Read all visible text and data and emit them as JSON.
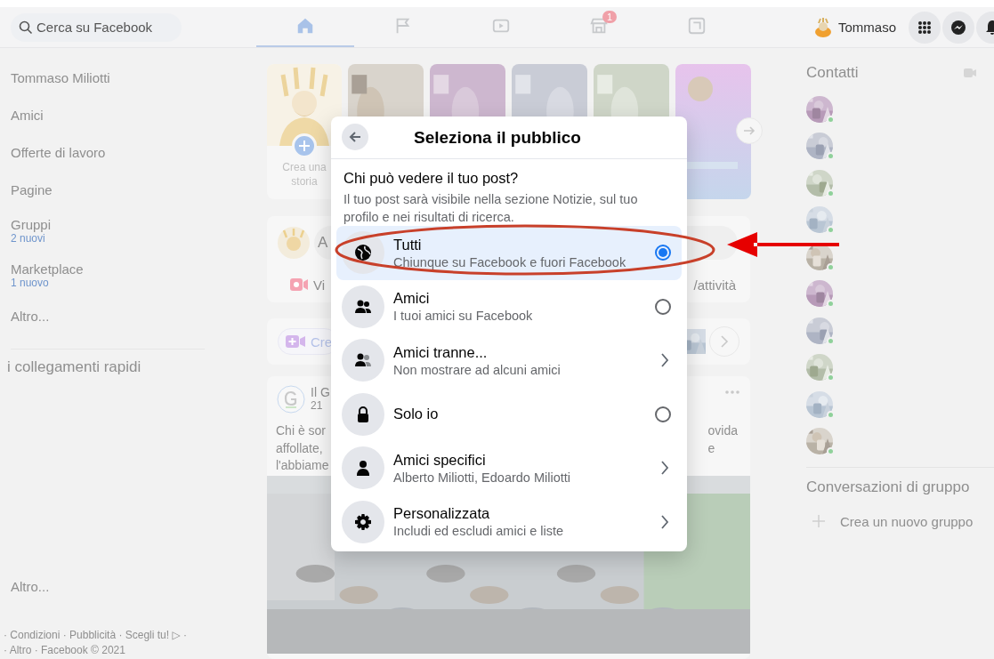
{
  "top_bar": {
    "search": {
      "placeholder": "Cerca su Facebook"
    },
    "nav_tabs": [
      {
        "kind": "home",
        "selected": true
      },
      {
        "kind": "pages",
        "selected": false
      },
      {
        "kind": "watch",
        "selected": false
      },
      {
        "kind": "marketplace",
        "selected": false,
        "badge": "1"
      },
      {
        "kind": "gaming",
        "selected": false
      }
    ],
    "profile": {
      "name": "Tommaso"
    },
    "actions": [
      {
        "kind": "menu"
      },
      {
        "kind": "messenger"
      },
      {
        "kind": "notifications"
      }
    ]
  },
  "sidebar": {
    "items": [
      {
        "label": "Tommaso Miliotti"
      },
      {
        "label": "Amici"
      },
      {
        "label": "Offerte di lavoro"
      },
      {
        "label": "Pagine"
      },
      {
        "label": "Gruppi",
        "note": "2 nuovi"
      },
      {
        "label": "Marketplace",
        "note": "1 nuovo"
      },
      {
        "label": "Altro..."
      }
    ],
    "shortcuts_title": "i collegamenti rapidi",
    "shortcuts_more": "Altro...",
    "footer": [
      "· Condizioni · Pubblicità · Scegli tu! ▷ ·",
      "· Altro · Facebook © 2021"
    ]
  },
  "feed": {
    "create_story": "Crea una storia",
    "stories": [
      {
        "kind": "picture"
      },
      {
        "kind": "picture"
      },
      {
        "kind": "picture"
      },
      {
        "kind": "picture"
      },
      {
        "kind": "gradient"
      }
    ],
    "composer": {
      "placeholder": "A",
      "actions": [
        "Vi",
        "/attività"
      ]
    },
    "room": {
      "label": "Cre"
    },
    "post": {
      "author": "Il G",
      "time": "21",
      "text_left": [
        "Chi è sor",
        "affollate,",
        "l'abbiame"
      ],
      "text_right": [
        "ovida",
        "e"
      ]
    }
  },
  "contacts": {
    "title": "Contatti",
    "people": [
      {
        "online": true
      },
      {
        "online": true
      },
      {
        "online": true
      },
      {
        "online": true
      },
      {
        "online": true
      },
      {
        "online": true
      },
      {
        "online": true
      },
      {
        "online": true
      },
      {
        "online": true
      },
      {
        "online": true
      }
    ],
    "groups_title": "Conversazioni di gruppo",
    "new_group": "Crea un nuovo gruppo"
  },
  "dialog": {
    "title": "Seleziona il pubblico",
    "question": "Chi può vedere il tuo post?",
    "description": "Il tuo post sarà visibile nella sezione Notizie, sul tuo profilo e nei risultati di ricerca.",
    "options": [
      {
        "kind": "globe",
        "title": "Tutti",
        "subtitle": "Chiunque su Facebook e fuori Facebook",
        "expandable": false,
        "selected": true
      },
      {
        "kind": "friends",
        "title": "Amici",
        "subtitle": "I tuoi amici su Facebook",
        "expandable": false,
        "selected": false
      },
      {
        "kind": "friends-except",
        "title": "Amici tranne...",
        "subtitle": "Non mostrare ad alcuni amici",
        "expandable": true,
        "selected": false
      },
      {
        "kind": "lock",
        "title": "Solo io",
        "expandable": false,
        "selected": false
      },
      {
        "kind": "person",
        "title": "Amici specifici",
        "subtitle": "Alberto Miliotti, Edoardo Miliotti",
        "expandable": true,
        "selected": false
      },
      {
        "kind": "gear",
        "title": "Personalizzata",
        "subtitle": "Includi ed escludi amici e liste",
        "expandable": true,
        "selected": false
      }
    ]
  },
  "highlight": {
    "ellipse": true,
    "arrow": true
  }
}
